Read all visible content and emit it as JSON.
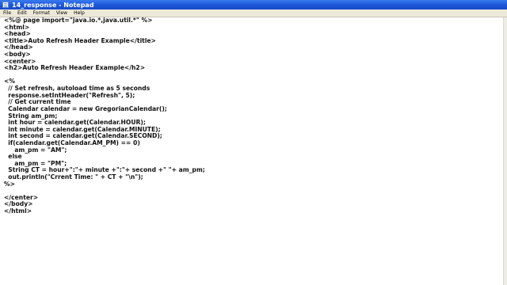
{
  "window": {
    "title": "14_response - Notepad"
  },
  "menu": {
    "items": [
      "File",
      "Edit",
      "Format",
      "View",
      "Help"
    ]
  },
  "editor": {
    "lines": [
      "<%@ page import=\"java.io.*,java.util.*\" %>",
      "<html>",
      "<head>",
      "<title>Auto Refresh Header Example</title>",
      "</head>",
      "<body>",
      "<center>",
      "<h2>Auto Refresh Header Example</h2>",
      "",
      "<%",
      "  // Set refresh, autoload time as 5 seconds",
      "  response.setIntHeader(\"Refresh\", 5);",
      "  // Get current time",
      "  Calendar calendar = new GregorianCalendar();",
      "  String am_pm;",
      "  int hour = calendar.get(Calendar.HOUR);",
      "  int minute = calendar.get(Calendar.MINUTE);",
      "  int second = calendar.get(Calendar.SECOND);",
      "  if(calendar.get(Calendar.AM_PM) == 0)",
      "     am_pm = \"AM\";",
      "  else",
      "     am_pm = \"PM\";",
      "  String CT = hour+\":\"+ minute +\":\"+ second +\" \"+ am_pm;",
      "  out.println(\"Crrent Time: \" + CT + \"\\n\");",
      "%>",
      "",
      "</center>",
      "</body>",
      "</html>"
    ]
  }
}
